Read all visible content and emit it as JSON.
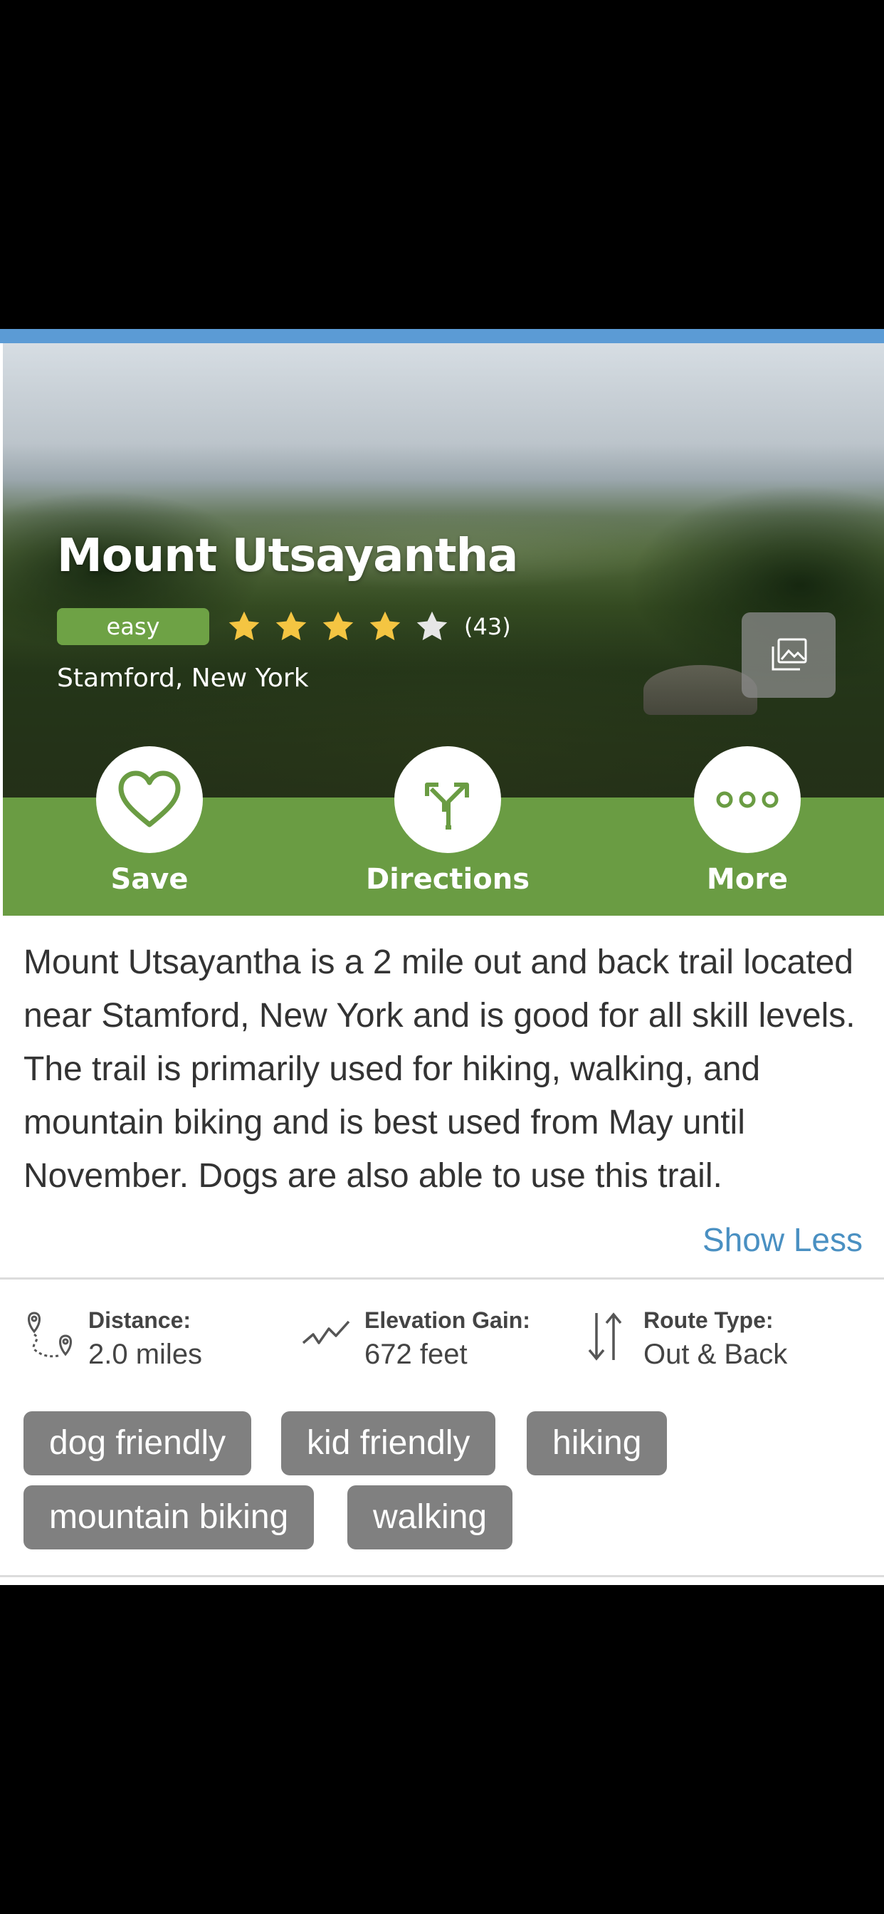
{
  "trail": {
    "name": "Mount Utsayantha",
    "difficulty": "easy",
    "rating": 4,
    "rating_max": 5,
    "reviews": "(43)",
    "location": "Stamford, New York"
  },
  "actions": {
    "save": "Save",
    "directions": "Directions",
    "more": "More"
  },
  "description": {
    "text": "Mount Utsayantha is a 2 mile out and back trail located near Stamford, New York and is good for all skill levels. The trail is primarily used for hiking, walking, and mountain biking and is best used from May until November. Dogs are also able to use this trail.",
    "toggle": "Show Less"
  },
  "stats": {
    "distance_label": "Distance:",
    "distance_value": "2.0 miles",
    "elevation_label": "Elevation Gain:",
    "elevation_value": "672 feet",
    "route_label": "Route Type:",
    "route_value": "Out & Back"
  },
  "tags": [
    "dog friendly",
    "kid friendly",
    "hiking",
    "mountain biking",
    "walking"
  ],
  "colors": {
    "brand_green": "#6a9c43",
    "badge_green": "#6ea245",
    "star": "#f4c542",
    "link": "#4a90c2",
    "tag": "#808080",
    "top_strip": "#5b9bd5"
  },
  "icons": {
    "save": "heart-icon",
    "directions": "directions-icon",
    "more": "more-dots-icon",
    "gallery": "photo-gallery-icon",
    "distance": "distance-pins-icon",
    "elevation": "elevation-icon",
    "route": "route-arrows-icon"
  }
}
